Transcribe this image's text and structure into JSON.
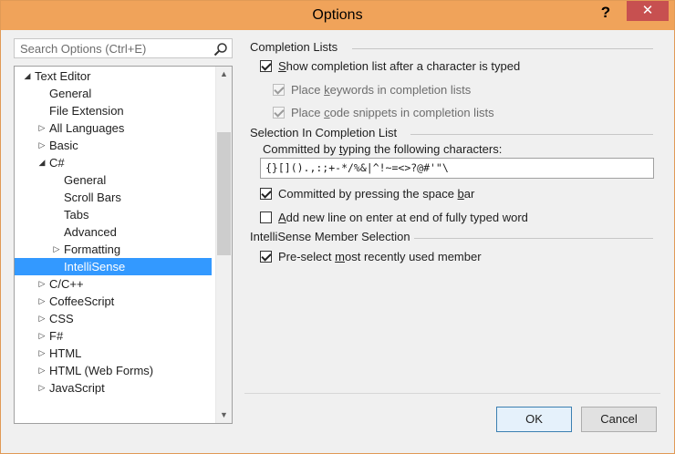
{
  "window": {
    "title": "Options",
    "help": "?",
    "close": "✕"
  },
  "search": {
    "placeholder": "Search Options (Ctrl+E)"
  },
  "tree": {
    "items": [
      {
        "label": "Text Editor",
        "level": 0,
        "expander": "expanded"
      },
      {
        "label": "General",
        "level": 1,
        "expander": "none"
      },
      {
        "label": "File Extension",
        "level": 1,
        "expander": "none"
      },
      {
        "label": "All Languages",
        "level": 1,
        "expander": "collapsed"
      },
      {
        "label": "Basic",
        "level": 1,
        "expander": "collapsed"
      },
      {
        "label": "C#",
        "level": 1,
        "expander": "expanded"
      },
      {
        "label": "General",
        "level": 2,
        "expander": "none"
      },
      {
        "label": "Scroll Bars",
        "level": 2,
        "expander": "none"
      },
      {
        "label": "Tabs",
        "level": 2,
        "expander": "none"
      },
      {
        "label": "Advanced",
        "level": 2,
        "expander": "none"
      },
      {
        "label": "Formatting",
        "level": 2,
        "expander": "collapsed"
      },
      {
        "label": "IntelliSense",
        "level": 2,
        "expander": "none",
        "selected": true
      },
      {
        "label": "C/C++",
        "level": 1,
        "expander": "collapsed"
      },
      {
        "label": "CoffeeScript",
        "level": 1,
        "expander": "collapsed"
      },
      {
        "label": "CSS",
        "level": 1,
        "expander": "collapsed"
      },
      {
        "label": "F#",
        "level": 1,
        "expander": "collapsed"
      },
      {
        "label": "HTML",
        "level": 1,
        "expander": "collapsed"
      },
      {
        "label": "HTML (Web Forms)",
        "level": 1,
        "expander": "collapsed"
      },
      {
        "label": "JavaScript",
        "level": 1,
        "expander": "collapsed"
      }
    ]
  },
  "completion": {
    "header": "Completion Lists",
    "show_list": {
      "pre": "",
      "key": "S",
      "post": "how completion list after a character is typed",
      "checked": true
    },
    "place_keywords": {
      "pre": "Place ",
      "key": "k",
      "post": "eywords in completion lists",
      "checked": true,
      "enabled": false
    },
    "place_snippets": {
      "pre": "Place ",
      "key": "c",
      "post": "ode snippets in completion lists",
      "checked": true,
      "enabled": false
    }
  },
  "selection": {
    "header": "Selection In Completion List",
    "committed_label": {
      "pre": "Committed by ",
      "key": "t",
      "post": "yping the following characters:"
    },
    "committed_chars": "{}[]().,:;+-*/%&|^!~=<>?@#'\"\\",
    "space_bar": {
      "pre": "Committed by pressing the space ",
      "key": "b",
      "post": "ar",
      "checked": true
    },
    "new_line": {
      "pre": "",
      "key": "A",
      "post": "dd new line on enter at end of fully typed word",
      "checked": false
    }
  },
  "member": {
    "header": "IntelliSense Member Selection",
    "preselect": {
      "pre": "Pre-select ",
      "key": "m",
      "post": "ost recently used member",
      "checked": true
    }
  },
  "buttons": {
    "ok": "OK",
    "cancel": "Cancel"
  }
}
